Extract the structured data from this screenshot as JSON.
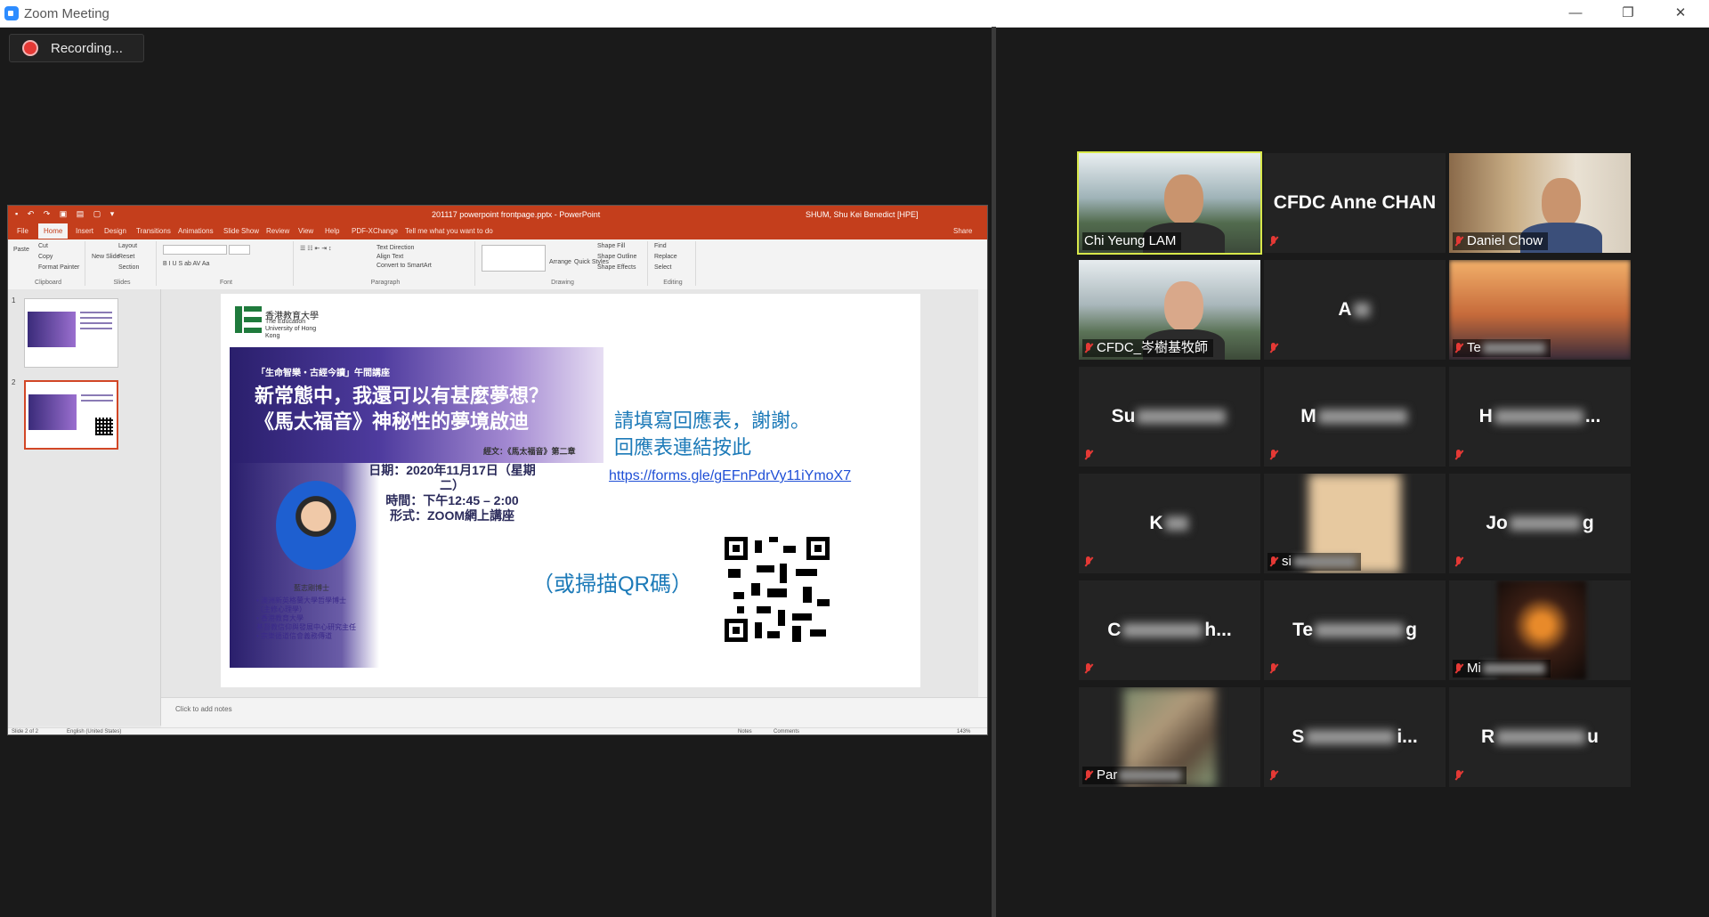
{
  "window": {
    "title": "Zoom Meeting",
    "minimize": "—",
    "restore": "❐",
    "close": "✕"
  },
  "recording": {
    "label": "Recording..."
  },
  "ppt": {
    "filename": "201117 powerpoint frontpage.pptx - PowerPoint",
    "user": "SHUM, Shu Kei Benedict [HPE]",
    "tabs": [
      "File",
      "Home",
      "Insert",
      "Design",
      "Transitions",
      "Animations",
      "Slide Show",
      "Review",
      "View",
      "Help",
      "PDF-XChange",
      "Tell me what you want to do"
    ],
    "share": "Share",
    "ribbon": {
      "clipboard": "Clipboard",
      "paste": "Paste",
      "cut": "Cut",
      "copy": "Copy",
      "format_painter": "Format Painter",
      "slides": "Slides",
      "new_slide": "New Slide",
      "layout": "Layout",
      "reset": "Reset",
      "section": "Section",
      "font": "Font",
      "paragraph": "Paragraph",
      "drawing": "Drawing",
      "editing": "Editing",
      "find": "Find",
      "replace": "Replace",
      "select": "Select",
      "arrange": "Arrange",
      "quick_styles": "Quick Styles",
      "text_direction": "Text Direction",
      "align_text": "Align Text",
      "smartart": "Convert to SmartArt",
      "shape_fill": "Shape Fill",
      "shape_outline": "Shape Outline",
      "shape_effects": "Shape Effects"
    },
    "thumbs": [
      {
        "num": "1"
      },
      {
        "num": "2"
      }
    ],
    "notes_placeholder": "Click to add notes",
    "status": {
      "slide": "Slide 2 of 2",
      "language": "English (United States)",
      "notes": "Notes",
      "comments": "Comments",
      "zoom": "143%"
    }
  },
  "slide": {
    "logo_cn": "香港教育大學",
    "logo_en": "The Education University of Hong Kong",
    "tag": "「生命智樂・古經今讀」午間講座",
    "headline_1": "新常態中，我還可以有甚麼夢想？",
    "headline_2": "《馬太福音》神秘性的夢境啟迪",
    "scripture": "經文：《馬太福音》第二章",
    "date": "日期：2020年11月17日（星期二）",
    "time": "時間：下午12:45 – 2:00",
    "format": "形式：ZOOM網上講座",
    "speaker": "藍志剛博士",
    "bullets": [
      "澳洲新英格蘭大學哲學博士",
      "（主修心理學）",
      "香港教育大學",
      "基督教信仰與發展中心研究主任",
      "宗樂循道信會義務傳道"
    ],
    "cta_1": "請填寫回應表，謝謝。",
    "cta_2": "回應表連結按此",
    "link": "https://forms.gle/gEFnPdrVy11iYmoX7",
    "qr_caption": "（或掃描QR碼）"
  },
  "participants": [
    {
      "name": "Chi Yeung LAM",
      "video": true,
      "active": true
    },
    {
      "name": "CFDC Anne CHAN",
      "video": false
    },
    {
      "name": "Daniel Chow",
      "video": true
    },
    {
      "name": "CFDC_岑樹基牧師",
      "video": true
    },
    {
      "name": "A",
      "video": false,
      "blurred": true
    },
    {
      "name": "Te",
      "video": true,
      "blurred": true
    },
    {
      "name": "Su",
      "video": false,
      "blurred": true
    },
    {
      "name": "M",
      "video": false,
      "blurred": true
    },
    {
      "name": "H",
      "video": false,
      "blurred": true
    },
    {
      "name": "K",
      "video": false,
      "blurred": true
    },
    {
      "name": "si",
      "video": true,
      "blurred": true
    },
    {
      "name": "Jo",
      "video": false,
      "blurred": true
    },
    {
      "name": "C",
      "video": false,
      "blurred": true
    },
    {
      "name": "Te",
      "video": false,
      "blurred": true
    },
    {
      "name": "Mi",
      "video": true,
      "blurred": true
    },
    {
      "name": "Par",
      "video": true,
      "blurred": true
    },
    {
      "name": "S",
      "video": false,
      "blurred": true
    },
    {
      "name": "R",
      "video": false,
      "blurred": true
    }
  ],
  "blurred_labels": {
    "A": "A",
    "Su": "Su",
    "M": "M",
    "H": "H",
    "K": "K",
    "Jo": "Jo",
    "C": "C",
    "Te2": "Te",
    "S": "S",
    "R": "R",
    "tails": {
      "Su": "",
      "M": "",
      "H": "...",
      "Jo": "g",
      "C": "h...",
      "Te2": "g",
      "S": "i...",
      "R": "u"
    }
  },
  "colors": {
    "zoom_blue": "#2d8cff",
    "ppt_red": "#c43e1c",
    "active_speaker": "#d8e84a",
    "muted": "#e53935"
  }
}
